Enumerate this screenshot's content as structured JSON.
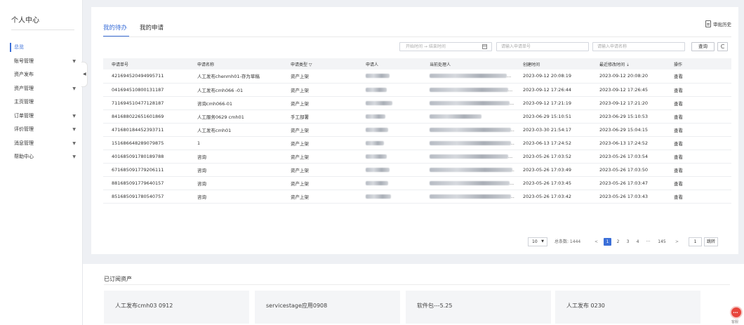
{
  "sidebar": {
    "title": "个人中心",
    "items": [
      {
        "label": "总览",
        "active": true,
        "expandable": false
      },
      {
        "label": "账号管理",
        "active": false,
        "expandable": true
      },
      {
        "label": "资产发布",
        "active": false,
        "expandable": false
      },
      {
        "label": "资产管理",
        "active": false,
        "expandable": true
      },
      {
        "label": "主页管理",
        "active": false,
        "expandable": false
      },
      {
        "label": "订单管理",
        "active": false,
        "expandable": true
      },
      {
        "label": "评价管理",
        "active": false,
        "expandable": true
      },
      {
        "label": "消息管理",
        "active": false,
        "expandable": true
      },
      {
        "label": "帮助中心",
        "active": false,
        "expandable": true
      }
    ],
    "chevron_glyph": "▼",
    "collapse_glyph": "◀"
  },
  "tabs": [
    {
      "label": "我的待办",
      "active": true
    },
    {
      "label": "我的申请",
      "active": false
    }
  ],
  "history_label": "审批历史",
  "filters": {
    "date_placeholder": "开始时间  →  结束时间",
    "request_no_placeholder": "请输入申请单号",
    "request_name_placeholder": "请输入申请名称",
    "query_label": "查询",
    "refresh_glyph": "C"
  },
  "table": {
    "columns": [
      "申请单号",
      "申请名称",
      "申请类型 ▽",
      "申请人",
      "当前处理人",
      "创建时间",
      "最近修改时间 ⇣",
      "操作"
    ],
    "rows": [
      {
        "no": "421694520494995711",
        "name": "人工发布chenmh01-存为草稿",
        "type": "资产上架",
        "created": "2023-09-12 20:08:19",
        "modified": "2023-09-12 20:08:20",
        "action": "查看"
      },
      {
        "no": "041694510800131187",
        "name": "人工发布cmh066 -01",
        "type": "资产上架",
        "created": "2023-09-12 17:26:44",
        "modified": "2023-09-12 17:26:45",
        "action": "查看"
      },
      {
        "no": "711694510477128187",
        "name": "咨询cmh066-01",
        "type": "资产上架",
        "created": "2023-09-12 17:21:19",
        "modified": "2023-09-12 17:21:20",
        "action": "查看"
      },
      {
        "no": "841688022651601869",
        "name": "人工服务0629 cmh01",
        "type": "手工部署",
        "created": "2023-06-29 15:10:51",
        "modified": "2023-06-29 15:10:53",
        "action": "查看"
      },
      {
        "no": "471680184452393711",
        "name": "人工发布cmh01",
        "type": "资产上架",
        "created": "2023-03-30 21:54:17",
        "modified": "2023-06-29 15:04:15",
        "action": "查看"
      },
      {
        "no": "151686648289079875",
        "name": "1",
        "type": "资产上架",
        "created": "2023-06-13 17:24:52",
        "modified": "2023-06-13 17:24:52",
        "action": "查看"
      },
      {
        "no": "401685091780189788",
        "name": "咨询",
        "type": "资产上架",
        "created": "2023-05-26 17:03:52",
        "modified": "2023-05-26 17:03:54",
        "action": "查看"
      },
      {
        "no": "671685091779206111",
        "name": "咨询",
        "type": "资产上架",
        "created": "2023-05-26 17:03:49",
        "modified": "2023-05-26 17:03:50",
        "action": "查看"
      },
      {
        "no": "881685091779640157",
        "name": "咨询",
        "type": "资产上架",
        "created": "2023-05-26 17:03:45",
        "modified": "2023-05-26 17:03:47",
        "action": "查看"
      },
      {
        "no": "851685091780540757",
        "name": "咨询",
        "type": "资产上架",
        "created": "2023-05-26 17:03:42",
        "modified": "2023-05-26 17:03:43",
        "action": "查看"
      }
    ],
    "ellipsis": "..."
  },
  "pagination": {
    "page_size": "10",
    "page_size_arrow": "▼",
    "total_label": "总条数: 1444",
    "prev": "<",
    "next": ">",
    "pages": [
      "1",
      "2",
      "3",
      "4",
      "···",
      "145"
    ],
    "current": "1",
    "jump_value": "1",
    "jump_label": "跳转"
  },
  "subscribed": {
    "title": "已订阅资产",
    "cards": [
      "人工发布cmh03 0912",
      "servicestage应用0908",
      "软件包---5.25",
      "人工发布 0230"
    ]
  },
  "assistant": {
    "label": "客服",
    "glyph": "•••"
  },
  "colors": {
    "accent": "#3b6fd8",
    "assistant": "#e8453c"
  }
}
